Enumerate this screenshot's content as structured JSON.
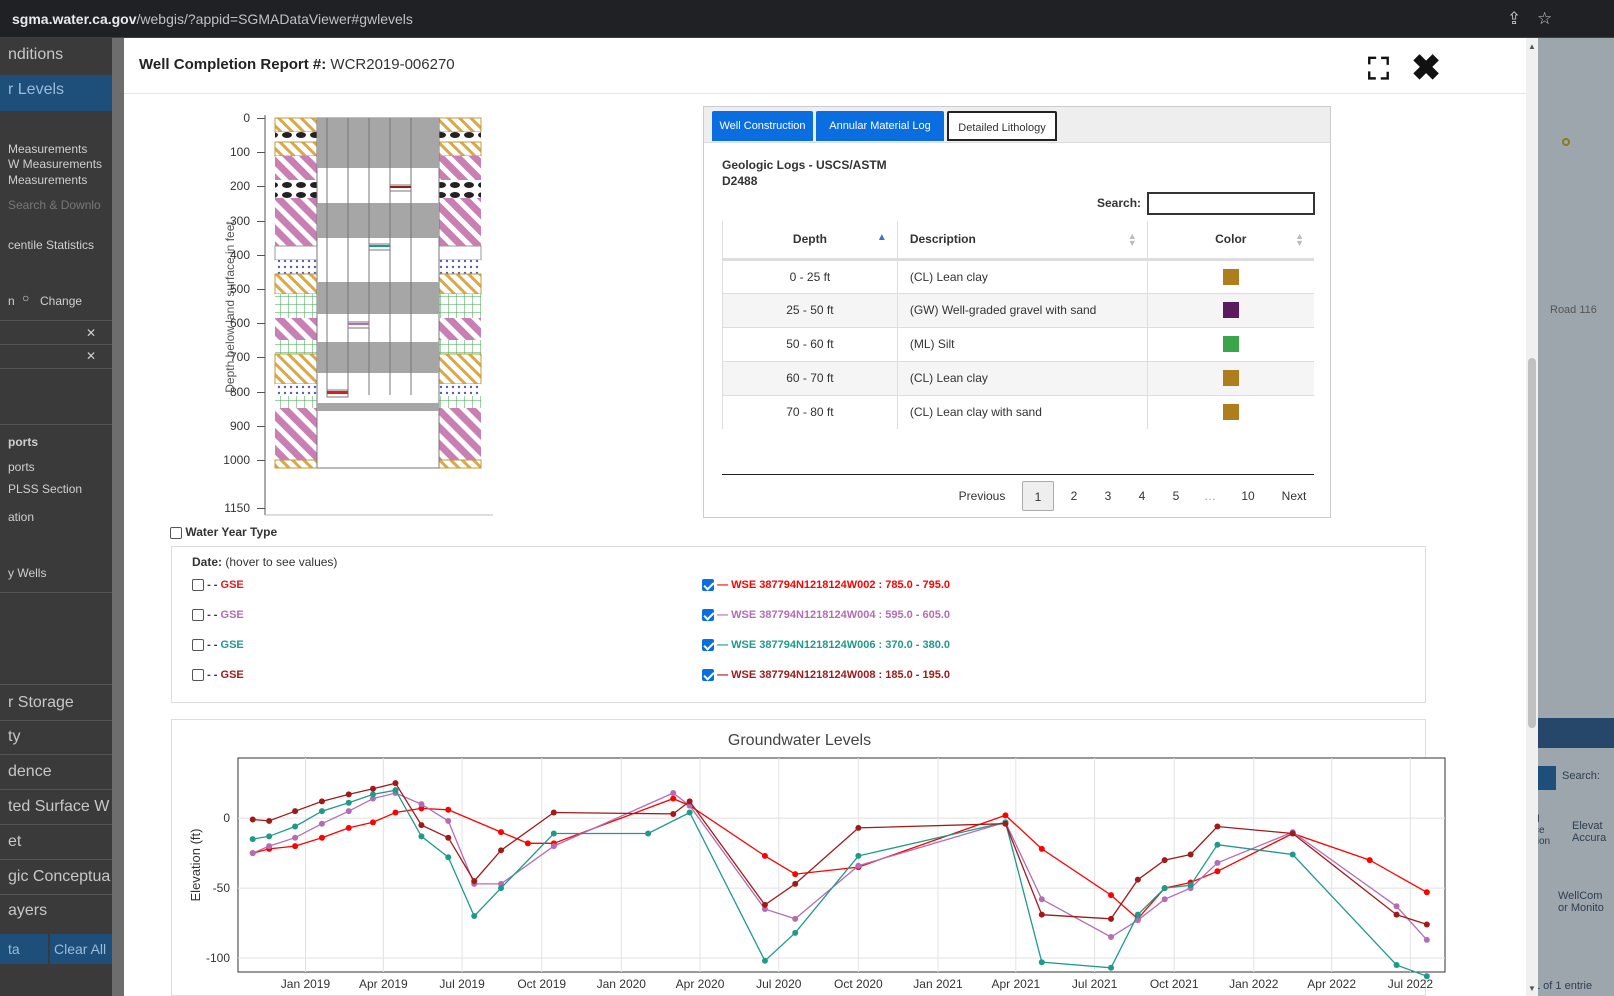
{
  "browser": {
    "url_host": "sgma.water.ca.gov",
    "url_path": "/webgis/?appid=SGMADataViewer#gwlevels"
  },
  "left_panel": {
    "items": [
      "nditions",
      "r Levels",
      "Measurements",
      "W Measurements",
      "Measurements",
      "Search & Downlo",
      "centile Statistics",
      "n",
      "Change",
      "ports",
      "ports",
      "PLSS Section",
      "ation",
      "y Wells",
      "r Storage",
      "ty",
      "dence",
      "ted Surface W",
      "et",
      "gic Conceptua",
      "ayers",
      "ta",
      "Clear All"
    ]
  },
  "right_panel": {
    "road_label": "Road 116",
    "search_label": "Search:",
    "col_1": "d\nce\ntion",
    "col_2": "Elevat\nAccura",
    "row_text": "WellCom\nor Monito",
    "footer": "1 of 1 entrie"
  },
  "modal": {
    "title_label": "Well Completion Report #:",
    "title_value": "WCR2019-006270"
  },
  "depth_axis": {
    "label": "Depth below land surface in feet",
    "ticks": [
      "0",
      "100",
      "200",
      "300",
      "400",
      "500",
      "600",
      "700",
      "800",
      "900",
      "1000",
      "1150"
    ]
  },
  "tabs": [
    "Well Construction",
    "Annular Material Log",
    "Detailed Lithology"
  ],
  "lithology": {
    "title_line1": "Geologic Logs - USCS/ASTM",
    "title_line2": "D2488",
    "search_label": "Search:",
    "headers": [
      "Depth",
      "Description",
      "Color"
    ],
    "rows": [
      {
        "depth": "0 - 25 ft",
        "desc": "(CL) Lean clay",
        "color": "#b07d1c"
      },
      {
        "depth": "25 - 50 ft",
        "desc": "(GW) Well-graded gravel with sand",
        "color": "#5c1b5c"
      },
      {
        "depth": "50 - 60 ft",
        "desc": "(ML) Silt",
        "color": "#3aa64a"
      },
      {
        "depth": "60 - 70 ft",
        "desc": "(CL) Lean clay",
        "color": "#b07d1c"
      },
      {
        "depth": "70 - 80 ft",
        "desc": "(CL) Lean clay with sand",
        "color": "#b07d1c"
      }
    ],
    "pager": [
      "Previous",
      "1",
      "2",
      "3",
      "4",
      "5",
      "…",
      "10",
      "Next"
    ]
  },
  "water_year_type": "Water Year Type",
  "legend": {
    "date_label": "Date:",
    "date_hint": "(hover to see values)",
    "gse": [
      {
        "label": "GSE",
        "color": "#e31a1c"
      },
      {
        "label": "GSE",
        "color": "#b46db4"
      },
      {
        "label": "GSE",
        "color": "#1f9a8a"
      },
      {
        "label": "GSE",
        "color": "#a01a1a"
      }
    ],
    "wse": [
      {
        "label": "WSE 387794N1218124W002 : 785.0 - 795.0",
        "color": "#ff0000"
      },
      {
        "label": "WSE 387794N1218124W004 : 595.0 - 605.0",
        "color": "#b46db4"
      },
      {
        "label": "WSE 387794N1218124W006 : 370.0 - 380.0",
        "color": "#1f9a8a"
      },
      {
        "label": "WSE 387794N1218124W008 : 185.0 - 195.0",
        "color": "#a01a1a"
      }
    ]
  },
  "chart_data": {
    "type": "line",
    "title": "Groundwater Levels",
    "ylabel": "Elevation (ft)",
    "xlabel": "",
    "ylim": [
      -110,
      43
    ],
    "xlim": [
      "2018-10-15",
      "2022-08-10"
    ],
    "x_ticks": [
      "Jan 2019",
      "Apr 2019",
      "Jul 2019",
      "Oct 2019",
      "Jan 2020",
      "Apr 2020",
      "Jul 2020",
      "Oct 2020",
      "Jan 2021",
      "Apr 2021",
      "Jul 2021",
      "Oct 2021",
      "Jan 2022",
      "Apr 2022",
      "Jul 2022"
    ],
    "y_ticks": [
      0,
      -50,
      -100
    ],
    "series": [
      {
        "name": "WSE 387794N1218124W002 : 785.0 - 795.0",
        "color": "#ff0000",
        "points": [
          [
            "2018-11-01",
            -25
          ],
          [
            "2018-11-20",
            -22
          ],
          [
            "2018-12-20",
            -20
          ],
          [
            "2019-01-20",
            -14
          ],
          [
            "2019-02-20",
            -7
          ],
          [
            "2019-03-20",
            -3
          ],
          [
            "2019-04-15",
            4
          ],
          [
            "2019-05-15",
            7
          ],
          [
            "2019-06-15",
            6
          ],
          [
            "2019-08-15",
            -10
          ],
          [
            "2019-09-15",
            -18
          ],
          [
            "2019-10-15",
            -18
          ],
          [
            "2020-03-01",
            14
          ],
          [
            "2020-03-20",
            9
          ],
          [
            "2020-06-15",
            -27
          ],
          [
            "2020-07-20",
            -40
          ],
          [
            "2020-10-01",
            -35
          ],
          [
            "2021-03-20",
            2
          ],
          [
            "2021-05-01",
            -22
          ],
          [
            "2021-07-20",
            -55
          ],
          [
            "2021-08-20",
            -72
          ],
          [
            "2021-09-20",
            -50
          ],
          [
            "2021-10-20",
            -46
          ],
          [
            "2021-11-20",
            -38
          ],
          [
            "2022-02-15",
            -11
          ],
          [
            "2022-05-15",
            -30
          ],
          [
            "2022-07-20",
            -53
          ]
        ]
      },
      {
        "name": "WSE 387794N1218124W004 : 595.0 - 605.0",
        "color": "#b46db4",
        "points": [
          [
            "2018-11-01",
            -25
          ],
          [
            "2018-11-20",
            -20
          ],
          [
            "2018-12-20",
            -14
          ],
          [
            "2019-01-20",
            -4
          ],
          [
            "2019-02-20",
            5
          ],
          [
            "2019-03-20",
            14
          ],
          [
            "2019-04-15",
            18
          ],
          [
            "2019-05-15",
            10
          ],
          [
            "2019-06-15",
            -2
          ],
          [
            "2019-07-15",
            -47
          ],
          [
            "2019-08-15",
            -47
          ],
          [
            "2019-10-15",
            -20
          ],
          [
            "2020-03-01",
            18
          ],
          [
            "2020-03-20",
            9
          ],
          [
            "2020-06-15",
            -65
          ],
          [
            "2020-07-20",
            -72
          ],
          [
            "2020-10-01",
            -34
          ],
          [
            "2021-03-20",
            -3
          ],
          [
            "2021-05-01",
            -58
          ],
          [
            "2021-07-20",
            -85
          ],
          [
            "2021-08-20",
            -73
          ],
          [
            "2021-09-20",
            -58
          ],
          [
            "2021-10-20",
            -50
          ],
          [
            "2021-11-20",
            -32
          ],
          [
            "2022-02-15",
            -10
          ],
          [
            "2022-06-15",
            -63
          ],
          [
            "2022-07-20",
            -87
          ]
        ]
      },
      {
        "name": "WSE 387794N1218124W006 : 370.0 - 380.0",
        "color": "#1f9a8a",
        "points": [
          [
            "2018-11-01",
            -15
          ],
          [
            "2018-11-20",
            -13
          ],
          [
            "2018-12-20",
            -6
          ],
          [
            "2019-01-20",
            5
          ],
          [
            "2019-02-20",
            11
          ],
          [
            "2019-03-20",
            17
          ],
          [
            "2019-04-15",
            20
          ],
          [
            "2019-05-15",
            -13
          ],
          [
            "2019-06-15",
            -28
          ],
          [
            "2019-07-15",
            -70
          ],
          [
            "2019-08-15",
            -50
          ],
          [
            "2019-10-15",
            -11
          ],
          [
            "2020-02-01",
            -11
          ],
          [
            "2020-03-20",
            4
          ],
          [
            "2020-06-15",
            -102
          ],
          [
            "2020-07-20",
            -82
          ],
          [
            "2020-10-01",
            -27
          ],
          [
            "2021-03-20",
            -3
          ],
          [
            "2021-05-01",
            -103
          ],
          [
            "2021-07-20",
            -107
          ],
          [
            "2021-08-20",
            -69
          ],
          [
            "2021-09-20",
            -50
          ],
          [
            "2021-10-20",
            -48
          ],
          [
            "2021-11-20",
            -19
          ],
          [
            "2022-02-15",
            -26
          ],
          [
            "2022-06-15",
            -105
          ],
          [
            "2022-07-20",
            -113
          ]
        ]
      },
      {
        "name": "WSE 387794N1218124W008 : 185.0 - 195.0",
        "color": "#a01a1a",
        "points": [
          [
            "2018-11-01",
            -1
          ],
          [
            "2018-11-20",
            -2
          ],
          [
            "2018-12-20",
            5
          ],
          [
            "2019-01-20",
            12
          ],
          [
            "2019-02-20",
            17
          ],
          [
            "2019-03-20",
            21
          ],
          [
            "2019-04-15",
            25
          ],
          [
            "2019-05-15",
            -5
          ],
          [
            "2019-06-15",
            -14
          ],
          [
            "2019-07-15",
            -45
          ],
          [
            "2019-08-15",
            -23
          ],
          [
            "2019-10-15",
            4
          ],
          [
            "2020-03-01",
            3
          ],
          [
            "2020-03-20",
            12
          ],
          [
            "2020-06-15",
            -62
          ],
          [
            "2020-07-20",
            -47
          ],
          [
            "2020-10-01",
            -7
          ],
          [
            "2021-03-20",
            -4
          ],
          [
            "2021-05-01",
            -69
          ],
          [
            "2021-07-20",
            -72
          ],
          [
            "2021-08-20",
            -44
          ],
          [
            "2021-09-20",
            -30
          ],
          [
            "2021-10-20",
            -26
          ],
          [
            "2021-11-20",
            -6
          ],
          [
            "2022-02-15",
            -11
          ],
          [
            "2022-06-15",
            -69
          ],
          [
            "2022-07-20",
            -76
          ]
        ]
      }
    ]
  }
}
